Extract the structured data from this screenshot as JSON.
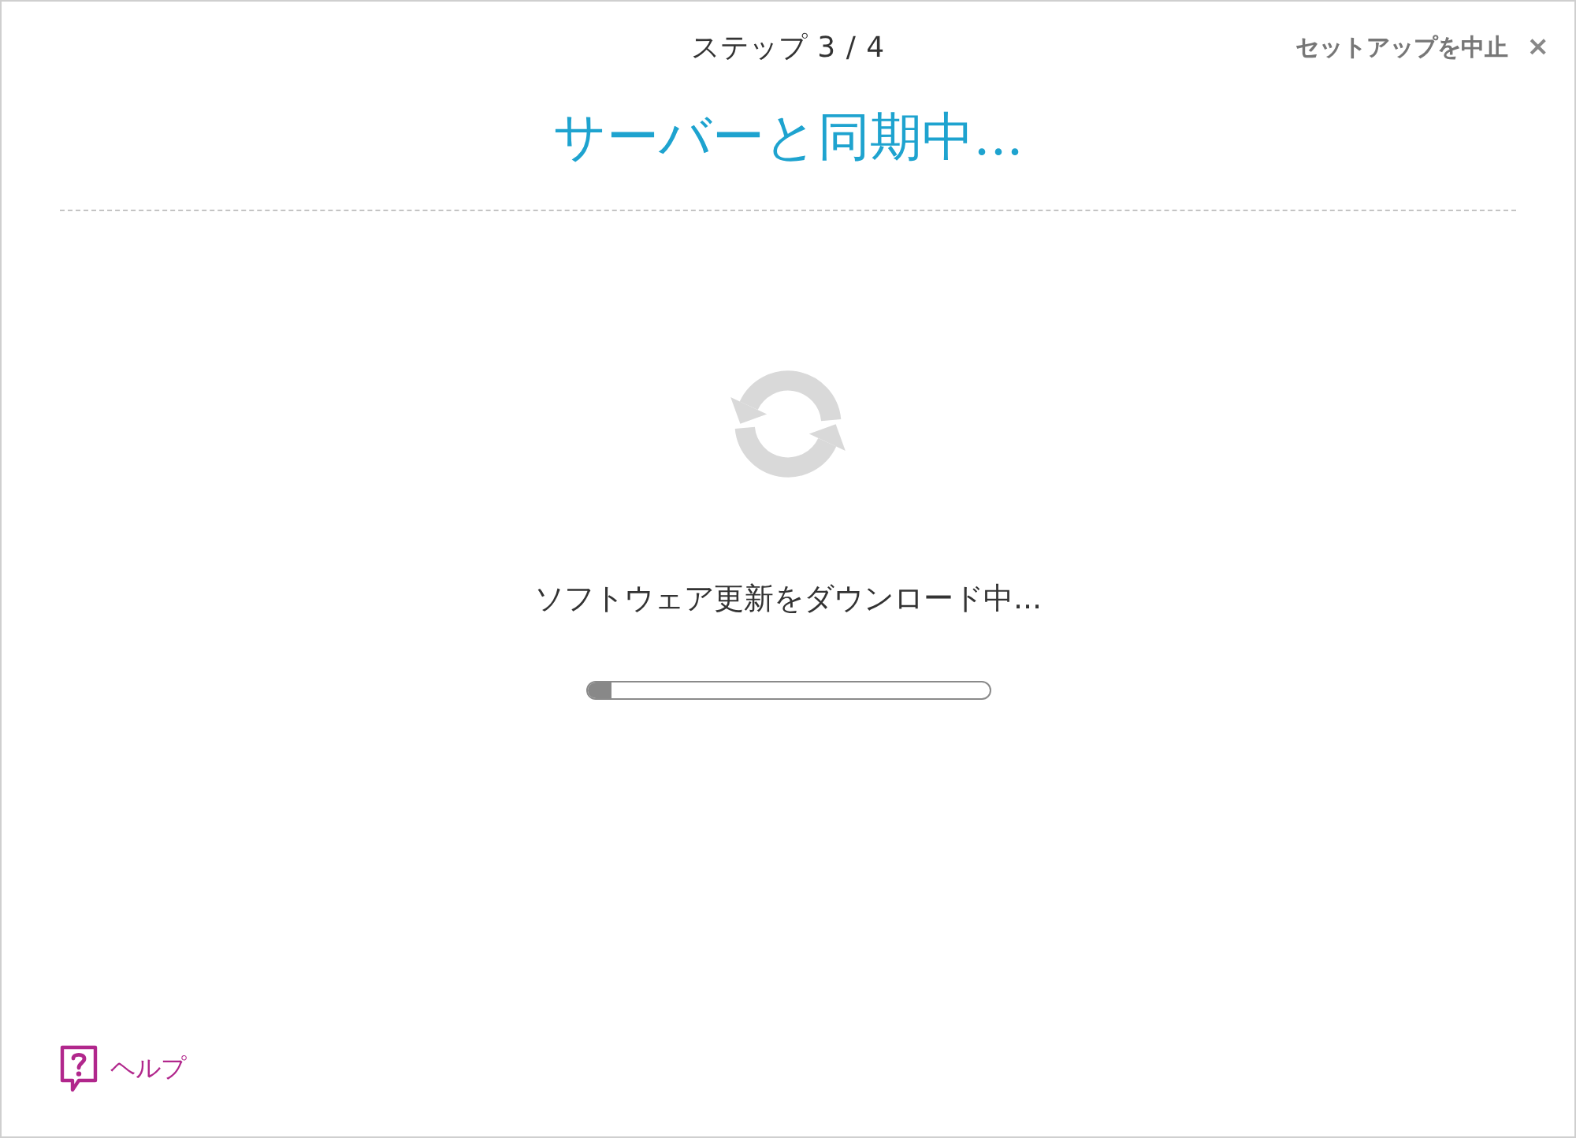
{
  "header": {
    "step": "ステップ 3 / 4",
    "cancel": {
      "label": "セットアップを中止",
      "close_mark": "×"
    }
  },
  "title": "サーバーと同期中...",
  "status": {
    "message": "ソフトウェア更新をダウンロード中...",
    "progress": {
      "level": 0.06
    }
  },
  "help": {
    "label": "ヘルプ"
  }
}
